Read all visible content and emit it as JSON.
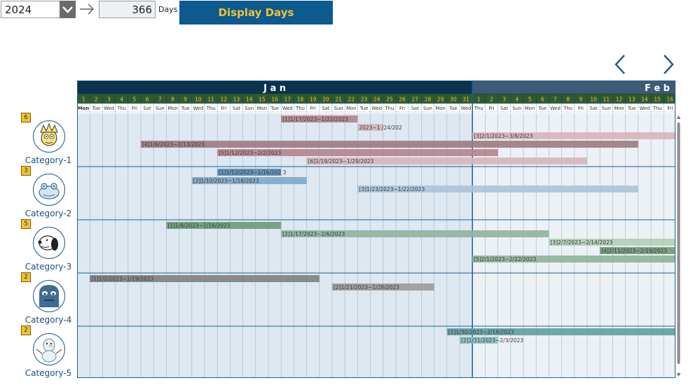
{
  "controls": {
    "year": "2024",
    "days": "366",
    "days_label": "Days",
    "display_button": "Display Days"
  },
  "icons": {
    "dropdown": "chevron-down-icon",
    "arrow": "right-arrow-icon",
    "prev": "chevron-left-icon",
    "next": "chevron-right-icon"
  },
  "colors": {
    "header_dark": "#0d3250",
    "header_light": "#3e5a78",
    "date_row": "#2d5a32",
    "date_text": "#f1c232",
    "button_bg": "#0d5a8f",
    "button_text": "#f1c232",
    "jan_bg": "#dde8f1",
    "feb_bg": "#ecf1f5"
  },
  "calendar": {
    "months": [
      {
        "label": "J a n",
        "days": 31,
        "weekdays": [
          "Mon",
          "Tue",
          "Wed",
          "Thu",
          "Fri",
          "Sat",
          "Sun",
          "Mon",
          "Tue",
          "Wed",
          "Thu",
          "Fri",
          "Sat",
          "Sun",
          "Mon",
          "Tue",
          "Wed",
          "Thu",
          "Fri",
          "Sat",
          "Sun",
          "Mon",
          "Tue",
          "Wed",
          "Thu",
          "Fri",
          "Sat",
          "Sun",
          "Mon",
          "Tue",
          "Wed"
        ]
      },
      {
        "label": "F e b",
        "days": 16,
        "weekdays": [
          "Thu",
          "Fri",
          "Sat",
          "Sun",
          "Mon",
          "Tue",
          "Wed",
          "Thu",
          "Fri",
          "Sat",
          "Sun",
          "Mon",
          "Tue",
          "Wed",
          "Thu",
          "Fri"
        ]
      }
    ]
  },
  "categories": [
    {
      "name": "Category-1",
      "count": "6",
      "avatar": "lisa-cartoon-icon",
      "bars": [
        {
          "label": "[1]1/17/2023~1/22/2023",
          "start": 17,
          "end": 22,
          "lane": 0,
          "color": "#b5838d",
          "truncated": false
        },
        {
          "label": "2023~1 /24/202",
          "start": 23,
          "end": 24,
          "lane": 1,
          "color": "#d8b4bb",
          "truncated": true
        },
        {
          "label": "[3]2/1/2023~3/8/2023",
          "start": 32,
          "end": 47,
          "lane": 2,
          "color": "#d8b4bb",
          "truncated": false
        },
        {
          "label": "[4]1/6/2023~2/13/2023",
          "start": 6,
          "end": 44,
          "lane": 3,
          "color": "#9e7a82",
          "truncated": false
        },
        {
          "label": "[5]1/12/2023~2/2/2023",
          "start": 12,
          "end": 33,
          "lane": 4,
          "color": "#b5838d",
          "truncated": false
        },
        {
          "label": "[6]1/19/2023~1/29/2023",
          "start": 19,
          "end": 29,
          "lane": 5,
          "color": "#d8b4bb",
          "truncated": false
        },
        {
          "label": "",
          "start": 30,
          "end": 40,
          "lane": 5,
          "color": "#d8b4bb",
          "truncated": false
        }
      ]
    },
    {
      "name": "Category-2",
      "count": "3",
      "avatar": "frog-icon",
      "bars": [
        {
          "label": "[1]1/12/2023~1/16/202 3",
          "start": 12,
          "end": 16,
          "lane": 0,
          "color": "#5b8db3",
          "truncated": true
        },
        {
          "label": "[2]1/10/2023~1/18/2023",
          "start": 10,
          "end": 18,
          "lane": 1,
          "color": "#7ea8c9",
          "truncated": false
        },
        {
          "label": "[3]1/23/2023~1/22/2023",
          "start": 23,
          "end": 44,
          "lane": 2,
          "color": "#a9c4da",
          "truncated": false
        }
      ]
    },
    {
      "name": "Category-3",
      "count": "5",
      "avatar": "snoopy-icon",
      "bars": [
        {
          "label": "[1]1/8/2023~1/16/2023",
          "start": 8,
          "end": 16,
          "lane": 0,
          "color": "#6e9a78",
          "truncated": false
        },
        {
          "label": "[2]1/17/2023~2/6/2023",
          "start": 17,
          "end": 37,
          "lane": 1,
          "color": "#8fb39a",
          "truncated": false
        },
        {
          "label": "[3]2/7/2023~2/14/2023",
          "start": 38,
          "end": 47,
          "lane": 2,
          "color": "#b4cdb9",
          "truncated": false
        },
        {
          "label": "[4]2/11/2023~2/19/2023",
          "start": 42,
          "end": 47,
          "lane": 3,
          "color": "#6e9a78",
          "truncated": false
        },
        {
          "label": "[5]2/1/2023~2/22/2023",
          "start": 32,
          "end": 47,
          "lane": 4,
          "color": "#8fb39a",
          "truncated": false
        }
      ]
    },
    {
      "name": "Category-4",
      "count": "2",
      "avatar": "monster-icon",
      "bars": [
        {
          "label": "[1]1/2/2023~1/19/2023",
          "start": 2,
          "end": 19,
          "lane": 0,
          "color": "#7f7f7f",
          "truncated": false
        },
        {
          "label": "[2]1/21/2023~1/28/2023",
          "start": 21,
          "end": 28,
          "lane": 1,
          "color": "#9a9a9a",
          "truncated": false
        }
      ]
    },
    {
      "name": "Category-5",
      "count": "2",
      "avatar": "olaf-icon",
      "bars": [
        {
          "label": "[1]1/30/2023~2/18/2023",
          "start": 30,
          "end": 47,
          "lane": 0,
          "color": "#5f9ea0",
          "truncated": false
        },
        {
          "label": "[2]1/31/2023~2/3/2023",
          "start": 31,
          "end": 33,
          "lane": 1,
          "color": "#8fc1c2",
          "truncated": true
        }
      ]
    }
  ]
}
